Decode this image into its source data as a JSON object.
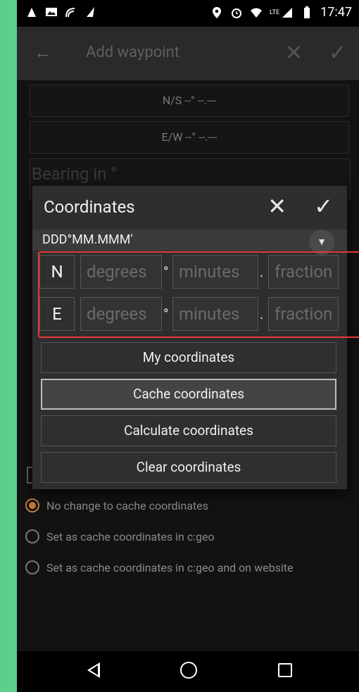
{
  "status_bar": {
    "time": "17:47",
    "network": "LTE"
  },
  "app_bar": {
    "title": "Add waypoint"
  },
  "background": {
    "lat_button": "N/S --° --.---",
    "lon_button": "E/W --° --.---",
    "bearing_placeholder": "Bearing in °",
    "options": [
      {
        "label": "No change to cache coordinates",
        "selected": true
      },
      {
        "label": "Set as cache coordinates in c:geo",
        "selected": false
      },
      {
        "label": "Set as cache coordinates in c:geo and on website",
        "selected": false
      }
    ]
  },
  "dialog": {
    "title": "Coordinates",
    "format": "DDD°MM.MMM'",
    "rows": [
      {
        "hemisphere": "N",
        "degrees_placeholder": "degrees",
        "minutes_placeholder": "minutes",
        "fraction_placeholder": "fraction"
      },
      {
        "hemisphere": "E",
        "degrees_placeholder": "degrees",
        "minutes_placeholder": "minutes",
        "fraction_placeholder": "fraction"
      }
    ],
    "degree_symbol": "°",
    "dot_symbol": ".",
    "buttons": {
      "my_coordinates": "My coordinates",
      "cache_coordinates": "Cache coordinates",
      "calculate_coordinates": "Calculate coordinates",
      "clear_coordinates": "Clear coordinates"
    }
  },
  "colors": {
    "accent": "#c2793a",
    "highlight": "#e53935",
    "frame": "#5ccf8a"
  }
}
